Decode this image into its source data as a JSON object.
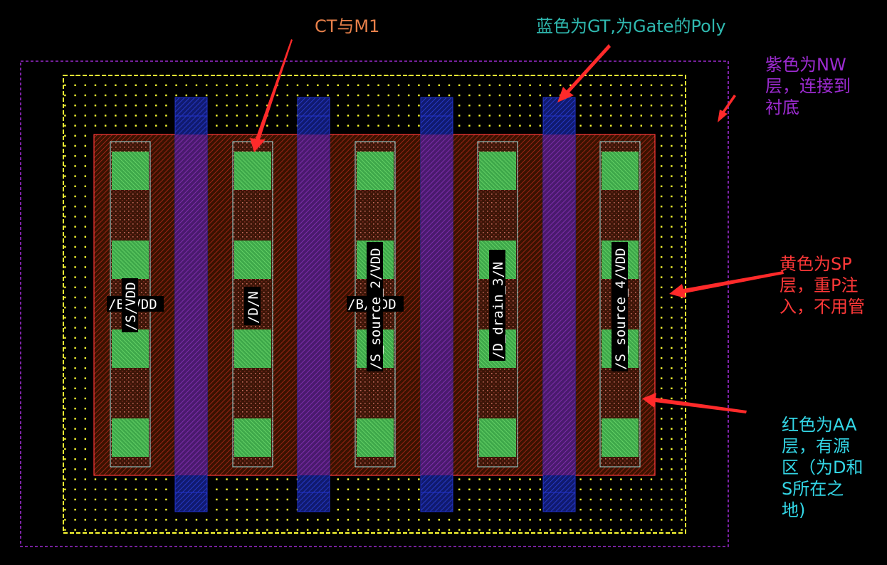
{
  "annotations": {
    "ct_m1": "CT与M1",
    "gt": "蓝色为GT,为Gate的Poly",
    "nw": [
      "紫色为NW",
      "层，连接到",
      "衬底"
    ],
    "sp": [
      "黄色为SP",
      "层，重P注",
      "入，不用管"
    ],
    "aa": [
      "红色为AA",
      "层，有源",
      "区（为D和",
      "S所在之",
      "地)"
    ]
  },
  "net_labels": {
    "col1_vertical": "/S/VDD",
    "col1_horizontal": "/B/VDD",
    "col2": "/D/N",
    "col3_vertical": "/S_source_2/VDD",
    "col3_horizontal": "/B/VDD",
    "col4": "/D_drain_3/N",
    "col5": "/S_source_4/VDD"
  },
  "colors": {
    "nw": "#9c2bd0",
    "sp": "#ffff33",
    "aa": "#ff3838",
    "gt": "#2233cc",
    "ct": "#5fd35f",
    "arrow": "#ff2a2a"
  }
}
